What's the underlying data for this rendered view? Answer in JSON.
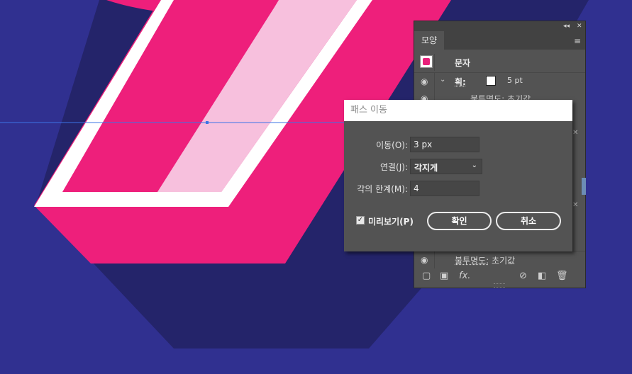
{
  "colors": {
    "background": "#303090",
    "shadow": "#24246a",
    "magenta": "#ee1f7b",
    "light_pink": "#f7c0dd",
    "stroke_white": "#ffffff",
    "guide_line": "#3b74e6",
    "panel": "#535353"
  },
  "appearance_panel": {
    "tab_label": "모양",
    "collapse_icon": "double-chevron-left",
    "close_icon": "x",
    "menu_icon": "hamburger",
    "header_label": "문자",
    "stroke": {
      "label": "획:",
      "swatch_color": "#ffffff",
      "weight": "5 pt"
    },
    "opacity_row_label": "불투명도:",
    "opacity_row_value": "초기값",
    "bottom_opacity_label": "불투명도:",
    "bottom_opacity_value": "초기값",
    "fx_label": "fx."
  },
  "offset_dialog": {
    "title": "패스 이동",
    "offset_label": "이동(O):",
    "offset_value": "3 px",
    "joins_label": "연결(J):",
    "joins_value": "각지게",
    "miter_label": "각의 한계(M):",
    "miter_value": "4",
    "preview_label": "미리보기(P)",
    "preview_checked": true,
    "ok_label": "확인",
    "cancel_label": "취소"
  }
}
